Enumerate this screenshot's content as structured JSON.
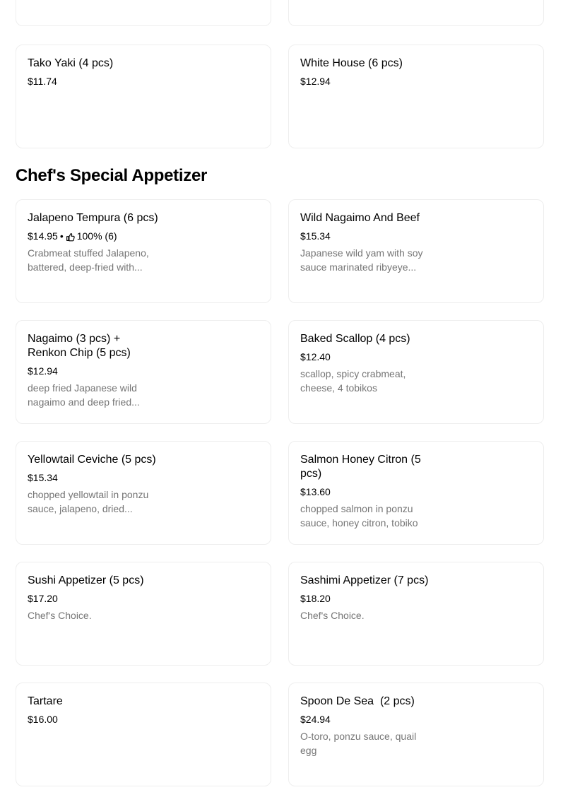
{
  "top_items": [
    {
      "name": "",
      "price": ""
    },
    {
      "name": "",
      "price": ""
    },
    {
      "name": "Tako Yaki (4 pcs)",
      "price": "$11.74"
    },
    {
      "name": "White House (6 pcs)",
      "price": "$12.94"
    }
  ],
  "section": {
    "title": "Chef's Special Appetizer",
    "items": [
      {
        "name": "Jalapeno Tempura (6 pcs)",
        "price": "$14.95",
        "separator": "•",
        "rating": "100% (6)",
        "description": "Crabmeat stuffed Jalapeno, battered, deep-fried with..."
      },
      {
        "name": "Wild Nagaimo And Beef",
        "price": "$15.34",
        "description": "Japanese wild yam with soy sauce marinated ribyeye..."
      },
      {
        "name": "Nagaimo (3 pcs) + Renkon Chip (5 pcs)",
        "price": "$12.94",
        "description": "deep fried Japanese wild nagaimo and deep fried..."
      },
      {
        "name": "Baked Scallop (4 pcs)",
        "price": "$12.40",
        "description": "scallop, spicy crabmeat, cheese, 4 tobikos"
      },
      {
        "name": "Yellowtail Ceviche (5 pcs)",
        "price": "$15.34",
        "description": "chopped yellowtail in ponzu sauce, jalapeno, dried..."
      },
      {
        "name": "Salmon Honey Citron (5 pcs)",
        "price": "$13.60",
        "description": "chopped salmon in ponzu sauce, honey citron, tobiko"
      },
      {
        "name": "Sushi Appetizer (5 pcs)",
        "price": "$17.20",
        "description": "Chef's Choice."
      },
      {
        "name": "Sashimi Appetizer (7 pcs)",
        "price": "$18.20",
        "description": "Chef's Choice."
      },
      {
        "name": "Tartare",
        "price": "$16.00",
        "description": ""
      },
      {
        "name": "Spoon De Sea  (2 pcs)",
        "price": "$24.94",
        "description": "O-toro, ponzu sauce, quail egg"
      }
    ]
  },
  "icons": {
    "rating": "thumbs-up-icon"
  }
}
